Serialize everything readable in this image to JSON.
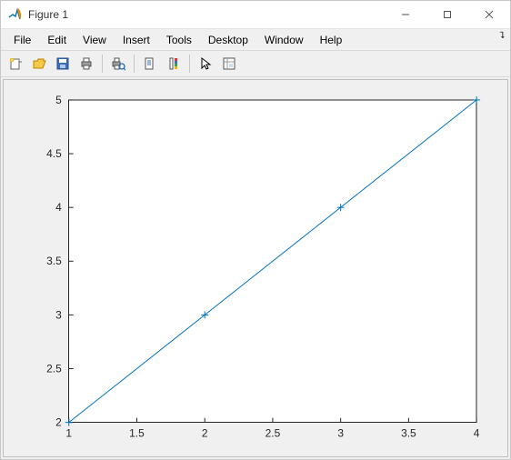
{
  "window": {
    "title": "Figure 1"
  },
  "menu": {
    "items": [
      "File",
      "Edit",
      "View",
      "Insert",
      "Tools",
      "Desktop",
      "Window",
      "Help"
    ]
  },
  "toolbar": {
    "icons": [
      "new-figure-icon",
      "open-icon",
      "save-icon",
      "print-icon",
      "|",
      "print-preview-icon",
      "|",
      "data-cursor-icon",
      "insert-colorbar-icon",
      "|",
      "pointer-icon",
      "plot-tools-icon"
    ]
  },
  "chart_data": {
    "type": "line",
    "x": [
      1,
      2,
      3,
      4
    ],
    "y": [
      2,
      3,
      4,
      5
    ],
    "marker": "+",
    "xlim": [
      1,
      4
    ],
    "ylim": [
      2,
      5
    ],
    "xticks": [
      1,
      1.5,
      2,
      2.5,
      3,
      3.5,
      4
    ],
    "yticks": [
      2,
      2.5,
      3,
      3.5,
      4,
      4.5,
      5
    ],
    "line_color": "#0072BD",
    "title": "",
    "xlabel": "",
    "ylabel": ""
  }
}
